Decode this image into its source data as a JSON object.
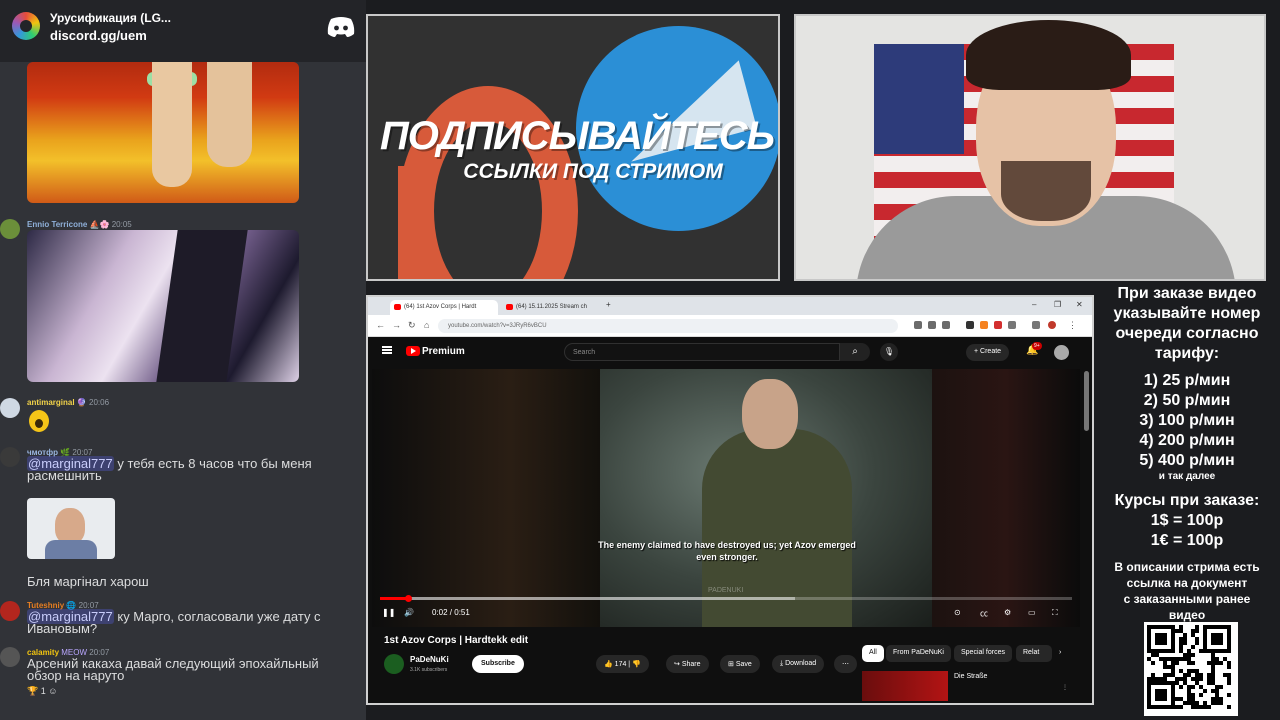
{
  "discord": {
    "server_title": "Урусификация (LG...",
    "invite": "discord.gg/uem",
    "messages": [
      {
        "name": "Ennio Terricone",
        "time": "20:05",
        "name_color": "#8fb0d9"
      },
      {
        "name": "antimarginal",
        "time": "20:06",
        "name_color": "#f2d34a"
      },
      {
        "name": "чмотфр",
        "time": "20:07",
        "name_color": "#9ab6e0",
        "mention": "@marginal777",
        "text": " у тебя есть 8 часов что бы меня",
        "text2": "расмешнить"
      },
      {
        "text": "Бля маргінал харош"
      },
      {
        "name": "Tuteshniy",
        "time": "20:07",
        "name_color": "#e67e22",
        "mention": "@marginal777",
        "text": " ку Марго, согласовали уже дату с",
        "text2": "Ивановым?"
      },
      {
        "name": "calamity",
        "badge": "MEOW",
        "time": "20:07",
        "name_color": "#f1c40f",
        "text": "Арсений какаха давай следующий эпохайльный",
        "text2": "обзор на наруто"
      }
    ],
    "reaction_count": "1"
  },
  "promo": {
    "headline": "ПОДПИСЫВАЙТЕСЬ",
    "subline": "ССЫЛКИ ПОД СТРИМОМ",
    "patreon_color": "#d75a3a",
    "telegram_color": "#2b8fd6"
  },
  "browser": {
    "tabs": [
      {
        "label": "(64) 1st Azov Corps | Hardt"
      },
      {
        "label": "(64) 15.11.2025 Stream ch"
      }
    ],
    "url": "youtube.com/watch?v=3JRyR6vBCU",
    "controls": {
      "min": "–",
      "max": "❐",
      "close": "✕"
    }
  },
  "youtube": {
    "brand": "Premium",
    "search_placeholder": "Search",
    "create_label": "Create",
    "notif_count": "9+",
    "caption_line1": "The enemy claimed to have destroyed us; yet Azov emerged",
    "caption_line2": "even stronger.",
    "watermark": "PADENUKI",
    "time_current": "0:02",
    "time_total": "0:51",
    "progress_fraction": 0.04,
    "buffer_fraction": 0.6,
    "video_title": "1st Azov Corps | Hardtekk edit",
    "channel_name": "PaDeNuKi",
    "channel_subs": "3.1K subscribers",
    "subscribe_label": "Subscribe",
    "likes": "174",
    "share_label": "Share",
    "save_label": "Save",
    "download_label": "Download",
    "chips": [
      "All",
      "From PaDeNuKi",
      "Special forces",
      "Relat"
    ],
    "rec_title": "Die Straße"
  },
  "info": {
    "line1": "При заказе видео",
    "line2": "указывайте номер",
    "line3": "очереди согласно",
    "line4": "тарифу:",
    "t1": "1) 25 р/мин",
    "t2": "2) 50 р/мин",
    "t3": "3) 100 р/мин",
    "t4": "4) 200 р/мин",
    "t5": "5) 400 р/мин",
    "t6": "и так далее",
    "rates_title": "Курсы при заказе:",
    "rate1": "1$ = 100р",
    "rate2": "1€ = 100р",
    "desc1": "В описании стрима есть",
    "desc2": "ссылка на документ",
    "desc3": "с заказанными ранее",
    "desc4": "видео"
  }
}
